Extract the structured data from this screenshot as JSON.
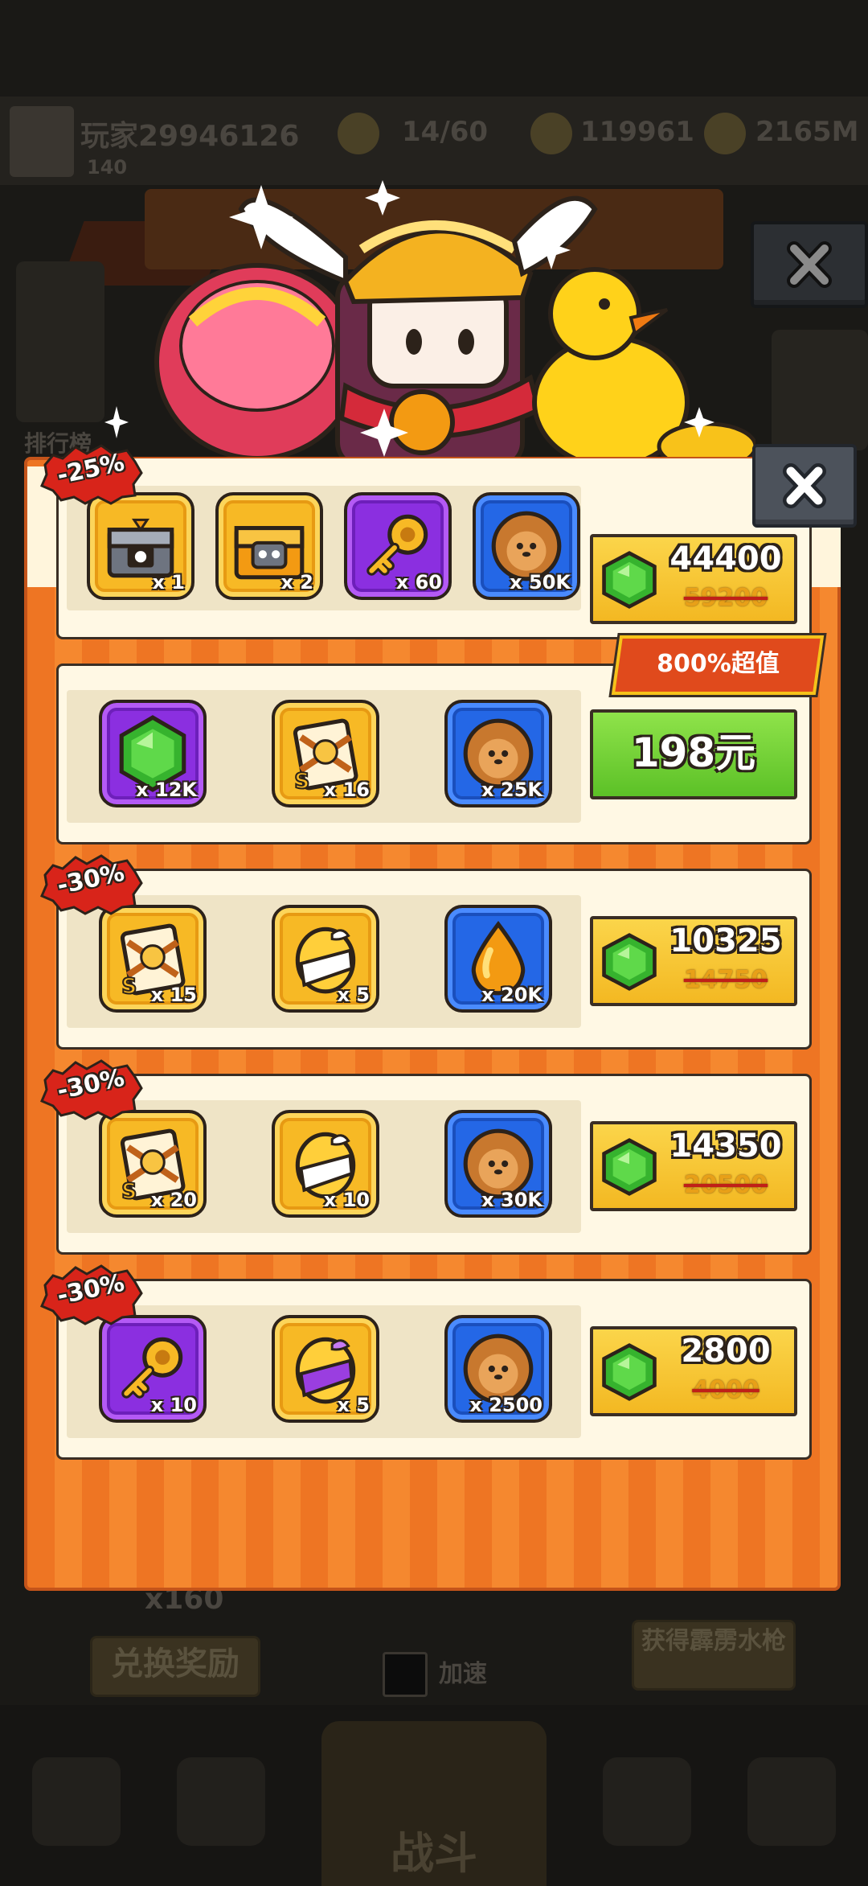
{
  "background": {
    "player_name": "玩家29946126",
    "player_sub": "140",
    "stat_1": "14/60",
    "stat_2": "119961",
    "stat_3": "2165M",
    "left_button_label": "排行榜",
    "stack_count": "x160",
    "exchange_button": "兑换奖励",
    "speed_label": "加速",
    "reward_button": "获得霹雳水枪",
    "fight_label": "战斗"
  },
  "offers": [
    {
      "discount": "-25%",
      "items": [
        {
          "icon": "chest-icon",
          "tile": "gold",
          "qty": "x 1"
        },
        {
          "icon": "chest-icon",
          "tile": "gold",
          "qty": "x 2"
        },
        {
          "icon": "key-icon",
          "tile": "purple",
          "qty": "x 60"
        },
        {
          "icon": "dog-cookie-icon",
          "tile": "blue",
          "qty": "x 50K"
        }
      ],
      "price": "44400",
      "old_price": "59200"
    },
    {
      "tag": "800%超值",
      "items": [
        {
          "icon": "gem-icon",
          "tile": "purple",
          "qty": "x 12K"
        },
        {
          "icon": "hero-card-icon",
          "tile": "gold",
          "qty": "x 16"
        },
        {
          "icon": "dog-cookie-icon",
          "tile": "blue",
          "qty": "x 25K"
        }
      ],
      "cash_price": "198元"
    },
    {
      "discount": "-30%",
      "items": [
        {
          "icon": "hero-card-icon",
          "tile": "gold",
          "qty": "x 15"
        },
        {
          "icon": "gift-egg-icon",
          "tile": "gold",
          "qty": "x 5"
        },
        {
          "icon": "oil-drop-icon",
          "tile": "blue",
          "qty": "x 20K"
        }
      ],
      "price": "10325",
      "old_price": "14750"
    },
    {
      "discount": "-30%",
      "items": [
        {
          "icon": "hero-card-icon",
          "tile": "gold",
          "qty": "x 20"
        },
        {
          "icon": "gift-egg-icon",
          "tile": "gold",
          "qty": "x 10"
        },
        {
          "icon": "dog-cookie-icon",
          "tile": "blue",
          "qty": "x 30K"
        }
      ],
      "price": "14350",
      "old_price": "20500"
    },
    {
      "discount": "-30%",
      "items": [
        {
          "icon": "key-icon",
          "tile": "purple",
          "qty": "x 10"
        },
        {
          "icon": "gift-egg-icon",
          "tile": "gold",
          "qty": "x 5"
        },
        {
          "icon": "dog-cookie-icon",
          "tile": "blue",
          "qty": "x 2500"
        }
      ],
      "price": "2800",
      "old_price": "4000"
    }
  ]
}
